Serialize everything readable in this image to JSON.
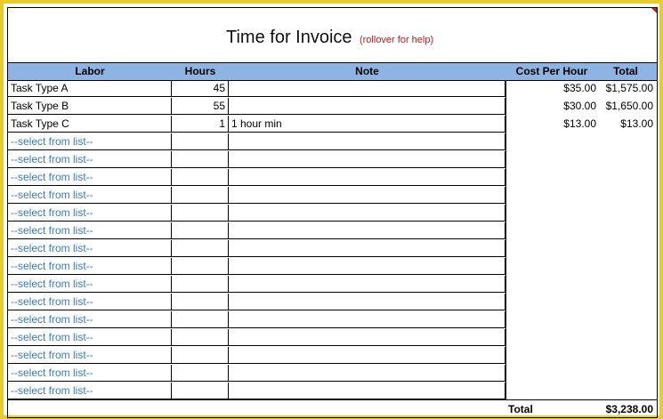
{
  "title": "Time for Invoice",
  "hint": "(rollover for help)",
  "headers": {
    "labor": "Labor",
    "hours": "Hours",
    "note": "Note",
    "cost": "Cost Per Hour",
    "total": "Total"
  },
  "rows": [
    {
      "labor": "Task Type A",
      "hours": "45",
      "note": "",
      "cost": "$35.00",
      "total": "$1,575.00"
    },
    {
      "labor": "Task Type B",
      "hours": "55",
      "note": "",
      "cost": "$30.00",
      "total": "$1,650.00"
    },
    {
      "labor": "Task Type C",
      "hours": "1",
      "note": "1 hour min",
      "cost": "$13.00",
      "total": "$13.00"
    },
    {
      "labor": "--select from list--",
      "hours": "",
      "note": "",
      "cost": "",
      "total": ""
    },
    {
      "labor": "--select from list--",
      "hours": "",
      "note": "",
      "cost": "",
      "total": ""
    },
    {
      "labor": "--select from list--",
      "hours": "",
      "note": "",
      "cost": "",
      "total": ""
    },
    {
      "labor": "--select from list--",
      "hours": "",
      "note": "",
      "cost": "",
      "total": ""
    },
    {
      "labor": "--select from list--",
      "hours": "",
      "note": "",
      "cost": "",
      "total": ""
    },
    {
      "labor": "--select from list--",
      "hours": "",
      "note": "",
      "cost": "",
      "total": ""
    },
    {
      "labor": "--select from list--",
      "hours": "",
      "note": "",
      "cost": "",
      "total": ""
    },
    {
      "labor": "--select from list--",
      "hours": "",
      "note": "",
      "cost": "",
      "total": ""
    },
    {
      "labor": "--select from list--",
      "hours": "",
      "note": "",
      "cost": "",
      "total": ""
    },
    {
      "labor": "--select from list--",
      "hours": "",
      "note": "",
      "cost": "",
      "total": ""
    },
    {
      "labor": "--select from list--",
      "hours": "",
      "note": "",
      "cost": "",
      "total": ""
    },
    {
      "labor": "--select from list--",
      "hours": "",
      "note": "",
      "cost": "",
      "total": ""
    },
    {
      "labor": "--select from list--",
      "hours": "",
      "note": "",
      "cost": "",
      "total": ""
    },
    {
      "labor": "--select from list--",
      "hours": "",
      "note": "",
      "cost": "",
      "total": ""
    },
    {
      "labor": "--select from list--",
      "hours": "",
      "note": "",
      "cost": "",
      "total": ""
    }
  ],
  "footer": {
    "label": "Total",
    "value": "$3,238.00"
  },
  "colors": {
    "frame": "#e8cc2a",
    "header_bg": "#8db4e2",
    "select_text": "#3a7bbf",
    "hint_text": "#c0191b"
  }
}
